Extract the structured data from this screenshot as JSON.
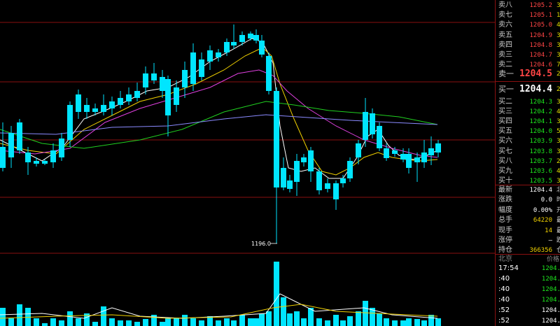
{
  "chart": {
    "low_marker_label": "1196.0",
    "colors": {
      "up": "#ff3030",
      "down": "#00e5ff",
      "ma5": "#ffffff",
      "ma10": "#f0d000",
      "ma20": "#e040e0",
      "ma40": "#20d020",
      "ma60": "#8a8aff",
      "grid": "#8a1010"
    }
  },
  "asks": [
    {
      "label": "卖八",
      "price": "1205.2",
      "vol": "3"
    },
    {
      "label": "卖七",
      "price": "1205.1",
      "vol": "1"
    },
    {
      "label": "卖六",
      "price": "1205.0",
      "vol": "4"
    },
    {
      "label": "卖五",
      "price": "1204.9",
      "vol": "3"
    },
    {
      "label": "卖四",
      "price": "1204.8",
      "vol": "3"
    },
    {
      "label": "卖三",
      "price": "1204.7",
      "vol": "3"
    },
    {
      "label": "卖二",
      "price": "1204.6",
      "vol": "7"
    }
  ],
  "ask1": {
    "label": "卖一",
    "price": "1204.5",
    "vol": "2"
  },
  "bid1": {
    "label": "买一",
    "price": "1204.4",
    "vol": "2"
  },
  "bids": [
    {
      "label": "买二",
      "price": "1204.3",
      "vol": "3"
    },
    {
      "label": "买三",
      "price": "1204.2",
      "vol": "4"
    },
    {
      "label": "买四",
      "price": "1204.1",
      "vol": "3"
    },
    {
      "label": "买五",
      "price": "1204.0",
      "vol": "5"
    },
    {
      "label": "买六",
      "price": "1203.9",
      "vol": "3"
    },
    {
      "label": "买七",
      "price": "1203.8",
      "vol": "3"
    },
    {
      "label": "买八",
      "price": "1203.7",
      "vol": "2"
    },
    {
      "label": "买九",
      "price": "1203.6",
      "vol": "4"
    },
    {
      "label": "买十",
      "price": "1203.5",
      "vol": "3"
    }
  ],
  "stats": [
    {
      "label": "最新",
      "value": "1204.4",
      "extra": "北"
    },
    {
      "label": "涨跌",
      "value": "0.0",
      "extra": "时"
    },
    {
      "label": "幅度",
      "value": "0.00%",
      "extra": "开"
    },
    {
      "label": "总手",
      "value": "64220",
      "extra": "最"
    },
    {
      "label": "现手",
      "value": "14",
      "extra": "最"
    },
    {
      "label": "涨停",
      "value": "—",
      "extra": "跌"
    },
    {
      "label": "持仓",
      "value": "366356",
      "extra": "仓"
    }
  ],
  "ticks_header": {
    "left": "北京",
    "right": "价格"
  },
  "ticks": [
    {
      "time": "17:54",
      "price": "1204.",
      "color": "grn"
    },
    {
      "time": ":40",
      "price": "1204.",
      "color": "grn"
    },
    {
      "time": ":40",
      "price": "1204.",
      "color": "grn"
    },
    {
      "time": ":40",
      "price": "1204.",
      "color": "grn"
    },
    {
      "time": ":52",
      "price": "1204.",
      "color": "wht"
    },
    {
      "time": ":52",
      "price": "1204.",
      "color": "wht"
    }
  ]
}
